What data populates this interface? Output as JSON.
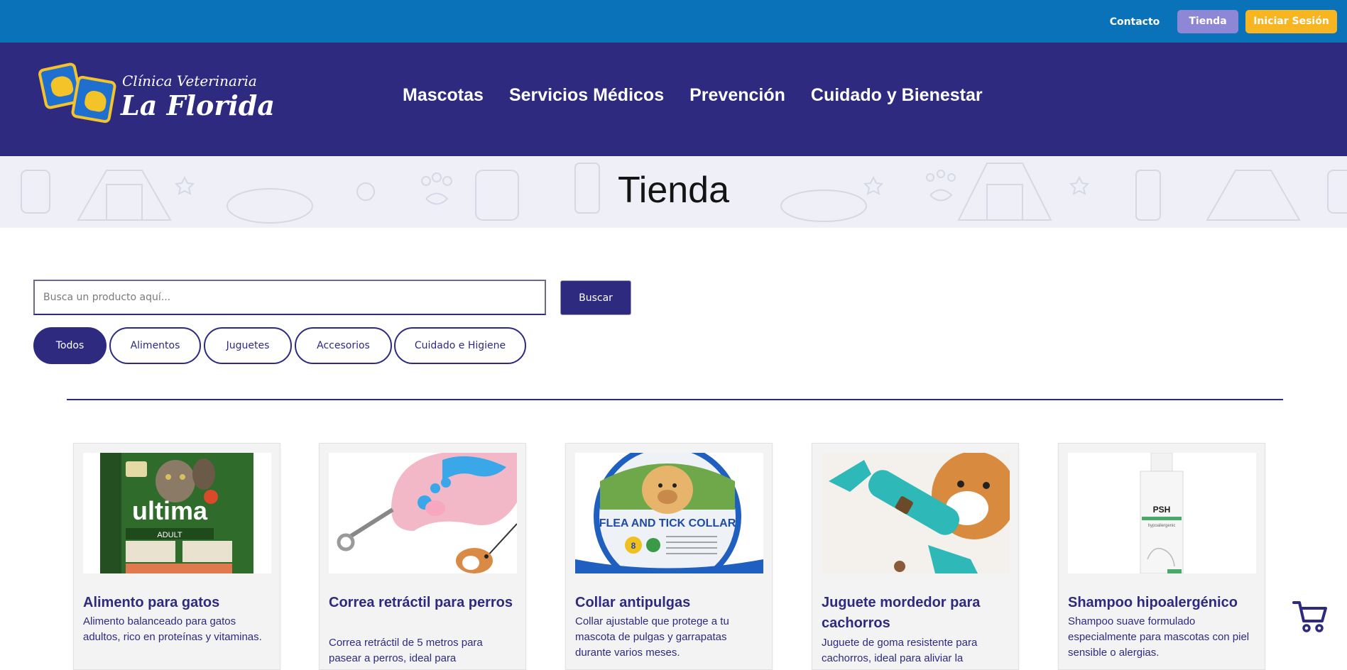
{
  "topbar": {
    "contact_label": "Contacto",
    "store_label": "Tienda",
    "login_label": "Iniciar Sesión"
  },
  "brand": {
    "line1": "Clínica Veterinaria",
    "line2": "La Florida",
    "logo_icon": "dogs-logo-icon"
  },
  "nav": {
    "items": [
      "Mascotas",
      "Servicios Médicos",
      "Prevención",
      "Cuidado y Bienestar"
    ]
  },
  "banner": {
    "title": "Tienda"
  },
  "search": {
    "placeholder": "Busca un producto aquí...",
    "value": "",
    "button_label": "Buscar"
  },
  "filters": {
    "selected": "Todos",
    "items": [
      "Todos",
      "Alimentos",
      "Juguetes",
      "Accesorios",
      "Cuidado e Higiene"
    ]
  },
  "products": [
    {
      "name": "Alimento para gatos",
      "description": "Alimento balanceado para gatos adultos, rico en proteínas y vitaminas.",
      "image_text": "ultima",
      "image_subtext": "ADULT"
    },
    {
      "name": "Correa retráctil para perros",
      "description": "Correa retráctil de 5 metros para pasear a perros, ideal para",
      "image_text": "",
      "image_subtext": ""
    },
    {
      "name": "Collar antipulgas",
      "description": "Collar ajustable que protege a tu mascota de pulgas y garrapatas durante varios meses.",
      "image_text": "FLEA AND TICK COLLAR",
      "image_subtext": "8"
    },
    {
      "name": "Juguete mordedor para cachorros",
      "description": "Juguete de goma resistente para cachorros, ideal para aliviar la",
      "image_text": "",
      "image_subtext": ""
    },
    {
      "name": "Shampoo hipoalergénico",
      "description": "Shampoo suave formulado especialmente para mascotas con piel sensible o alergias.",
      "image_text": "PSH",
      "image_subtext": "hypoallergenic"
    }
  ],
  "cart": {
    "icon": "shopping-cart-icon"
  },
  "colors": {
    "topbar": "#0a72b8",
    "navbar": "#2e2a80",
    "primary": "#2e2a80",
    "store_button": "#8d87d6",
    "login_button": "#f7b521",
    "banner_bg": "#eeeff7",
    "card_bg": "#f3f3f3"
  }
}
